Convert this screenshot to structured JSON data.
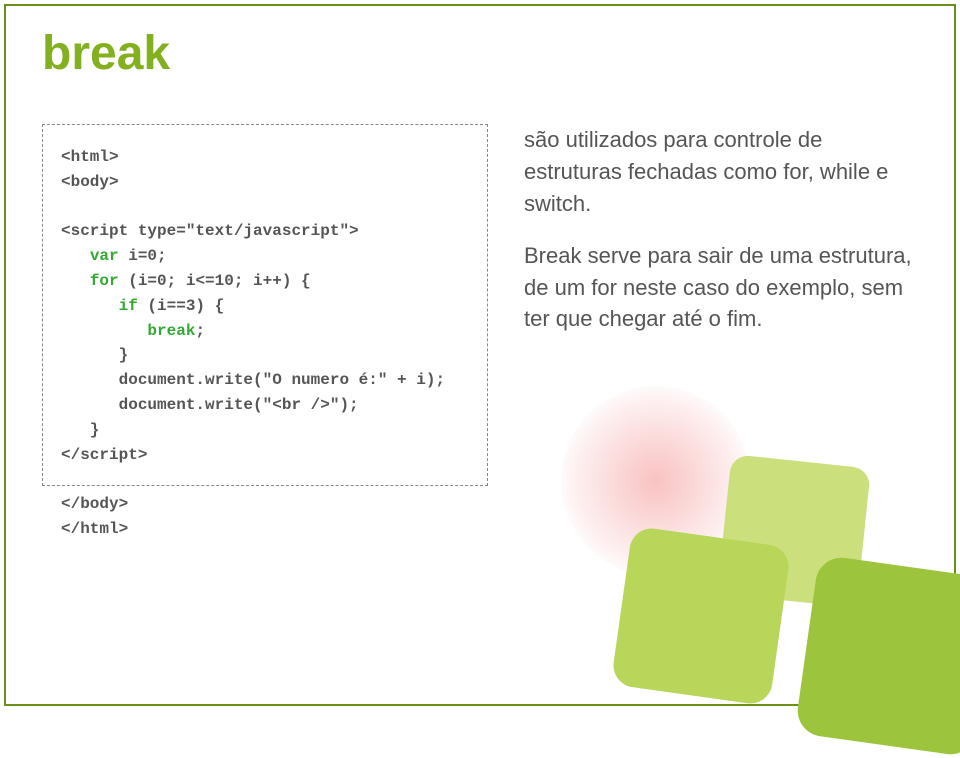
{
  "title": "break",
  "code": {
    "l1": "<html>",
    "l2": "<body>",
    "l3": "",
    "l4a": "<script type=\"text/javascript\">",
    "l5a": "   ",
    "l5b": "var",
    "l5c": " i=0;",
    "l6a": "   ",
    "l6b": "for",
    "l6c": " (i=0; i<=10; i++) {",
    "l7a": "      ",
    "l7b": "if",
    "l7c": " (i==3) {",
    "l8a": "         ",
    "l8b": "break",
    "l8c": ";",
    "l9": "      }",
    "l10": "      document.write(\"O numero é:\" + i);",
    "l11": "      document.write(\"<br />\");",
    "l12": "   }",
    "l13": "</script>",
    "l14": "",
    "l15": "</body>",
    "l16": "</html>"
  },
  "para1": "são utilizados para controle de estruturas fechadas como for, while e switch.",
  "para2": "Break serve para sair de uma estrutura, de um for neste caso do exemplo, sem ter que chegar até o fim."
}
